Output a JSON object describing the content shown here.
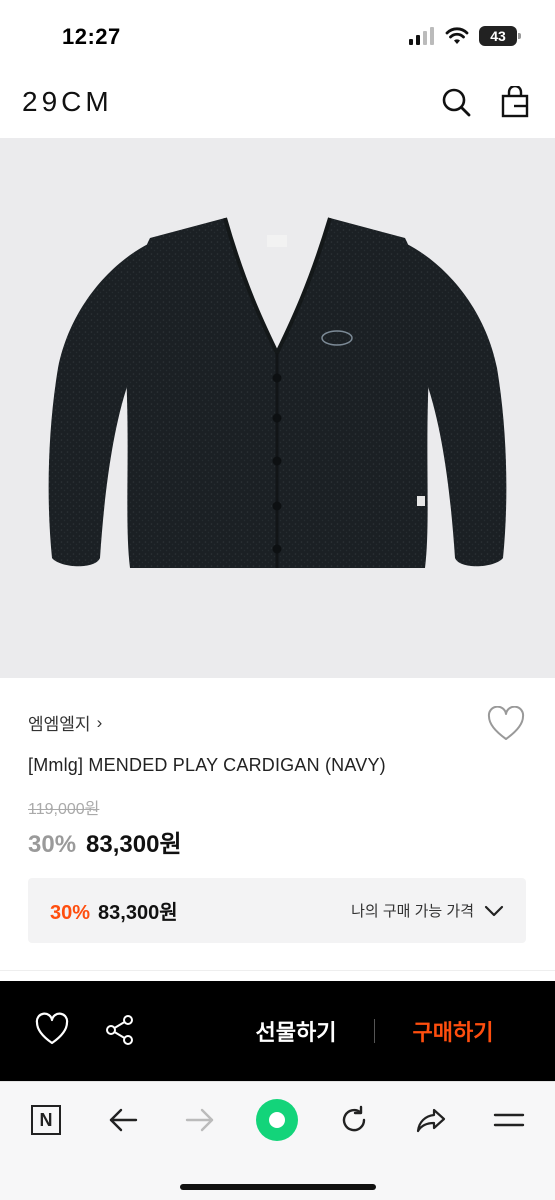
{
  "status": {
    "time": "12:27",
    "battery": "43"
  },
  "header": {
    "logo": "29CM"
  },
  "product": {
    "brand": "엠엠엘지",
    "brand_chevron": "›",
    "name": "[Mmlg] MENDED PLAY CARDIGAN (NAVY)",
    "original_price": "119,000원",
    "discount": "30%",
    "final_price": "83,300원"
  },
  "my_price": {
    "discount": "30%",
    "price": "83,300원",
    "label": "나의 구매 가능 가격"
  },
  "buy_bar": {
    "gift_label": "선물하기",
    "buy_label": "구매하기"
  },
  "browser": {
    "n_label": "N"
  },
  "colors": {
    "accent": "#ff4e0e",
    "naver_green": "#03c75a"
  }
}
